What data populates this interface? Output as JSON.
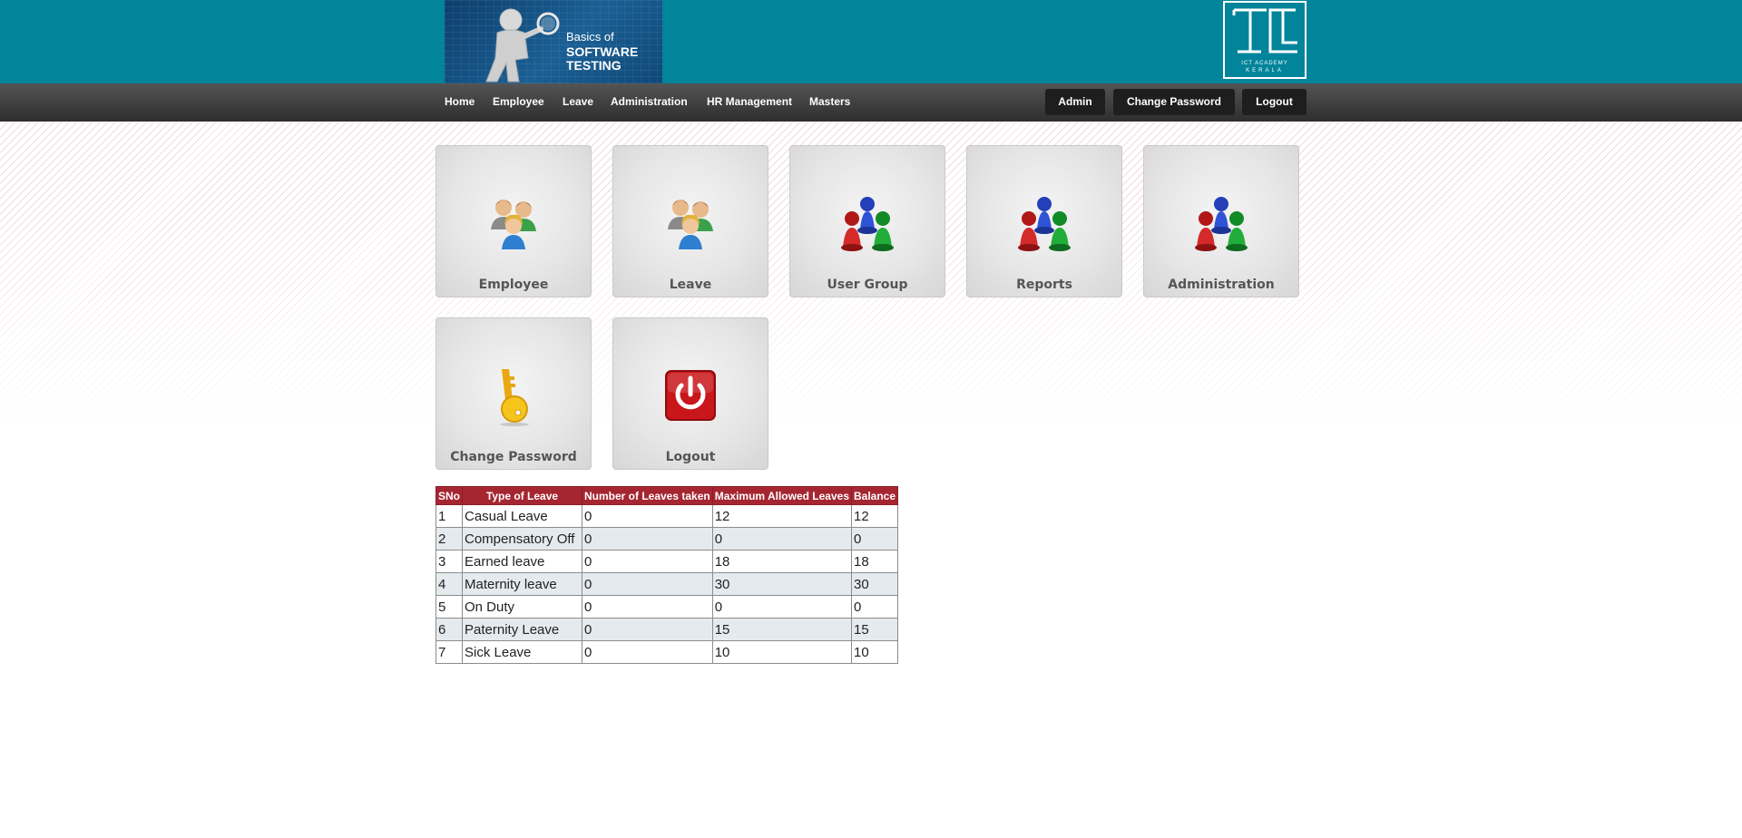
{
  "header": {
    "banner_lines": [
      "Basics of",
      "SOFTWARE",
      "TESTING"
    ],
    "logo_lines": [
      "ICT ACADEMY",
      "KERALA"
    ]
  },
  "nav": {
    "items": [
      "Home",
      "Employee",
      "Leave",
      "Administration",
      "HR Management",
      "Masters"
    ],
    "buttons": [
      "Admin",
      "Change Password",
      "Logout"
    ]
  },
  "tiles": [
    {
      "label": "Employee",
      "icon": "people-group-icon"
    },
    {
      "label": "Leave",
      "icon": "people-group-icon"
    },
    {
      "label": "User Group",
      "icon": "pawns-group-icon"
    },
    {
      "label": "Reports",
      "icon": "pawns-group-icon"
    },
    {
      "label": "Administration",
      "icon": "pawns-group-icon"
    },
    {
      "label": "Change Password",
      "icon": "key-icon"
    },
    {
      "label": "Logout",
      "icon": "power-icon"
    }
  ],
  "leave_table": {
    "headers": [
      "SNo",
      "Type of Leave",
      "Number of Leaves taken",
      "Maximum Allowed Leaves",
      "Balance"
    ],
    "rows": [
      [
        "1",
        "Casual Leave",
        "0",
        "12",
        "12"
      ],
      [
        "2",
        "Compensatory Off",
        "0",
        "0",
        "0"
      ],
      [
        "3",
        "Earned leave",
        "0",
        "18",
        "18"
      ],
      [
        "4",
        "Maternity leave",
        "0",
        "30",
        "30"
      ],
      [
        "5",
        "On Duty",
        "0",
        "0",
        "0"
      ],
      [
        "6",
        "Paternity Leave",
        "0",
        "15",
        "15"
      ],
      [
        "7",
        "Sick Leave",
        "0",
        "10",
        "10"
      ]
    ]
  },
  "colors": {
    "header_teal": "#02849b",
    "table_header": "#a52631",
    "row_alt": "#e5eaee"
  }
}
